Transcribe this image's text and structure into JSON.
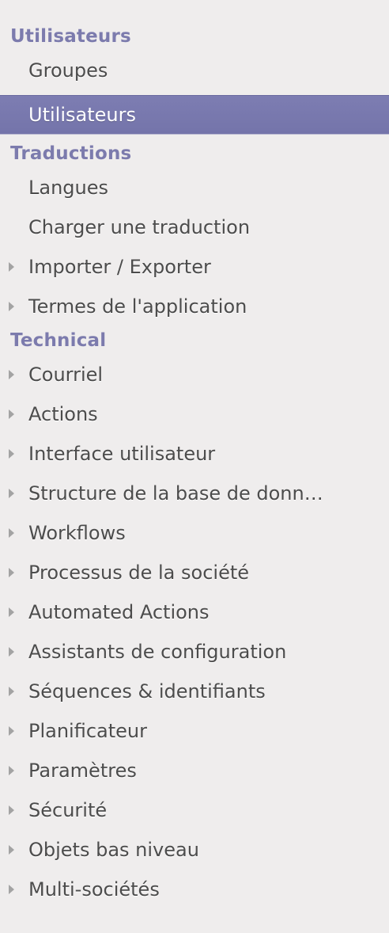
{
  "sections": [
    {
      "header": "Utilisateurs",
      "items": [
        {
          "label": "Groupes",
          "expandable": false,
          "active": false
        },
        {
          "label": "Utilisateurs",
          "expandable": false,
          "active": true
        }
      ]
    },
    {
      "header": "Traductions",
      "items": [
        {
          "label": "Langues",
          "expandable": false,
          "active": false
        },
        {
          "label": "Charger une traduction",
          "expandable": false,
          "active": false
        },
        {
          "label": "Importer / Exporter",
          "expandable": true,
          "active": false
        },
        {
          "label": "Termes de l'application",
          "expandable": true,
          "active": false
        }
      ]
    },
    {
      "header": "Technical",
      "items": [
        {
          "label": "Courriel",
          "expandable": true,
          "active": false
        },
        {
          "label": "Actions",
          "expandable": true,
          "active": false
        },
        {
          "label": "Interface utilisateur",
          "expandable": true,
          "active": false
        },
        {
          "label": "Structure de la base de donn…",
          "expandable": true,
          "active": false
        },
        {
          "label": "Workflows",
          "expandable": true,
          "active": false
        },
        {
          "label": "Processus de la société",
          "expandable": true,
          "active": false
        },
        {
          "label": "Automated Actions",
          "expandable": true,
          "active": false
        },
        {
          "label": "Assistants de configuration",
          "expandable": true,
          "active": false
        },
        {
          "label": "Séquences & identifiants",
          "expandable": true,
          "active": false
        },
        {
          "label": "Planificateur",
          "expandable": true,
          "active": false
        },
        {
          "label": "Paramètres",
          "expandable": true,
          "active": false
        },
        {
          "label": "Sécurité",
          "expandable": true,
          "active": false
        },
        {
          "label": "Objets bas niveau",
          "expandable": true,
          "active": false
        },
        {
          "label": "Multi-sociétés",
          "expandable": true,
          "active": false
        }
      ]
    }
  ],
  "colors": {
    "background": "#efeded",
    "section_header": "#7c7bad",
    "active_bg": "#7777ab",
    "item_text": "#4c4c4c",
    "caret": "#a3a3a3"
  }
}
